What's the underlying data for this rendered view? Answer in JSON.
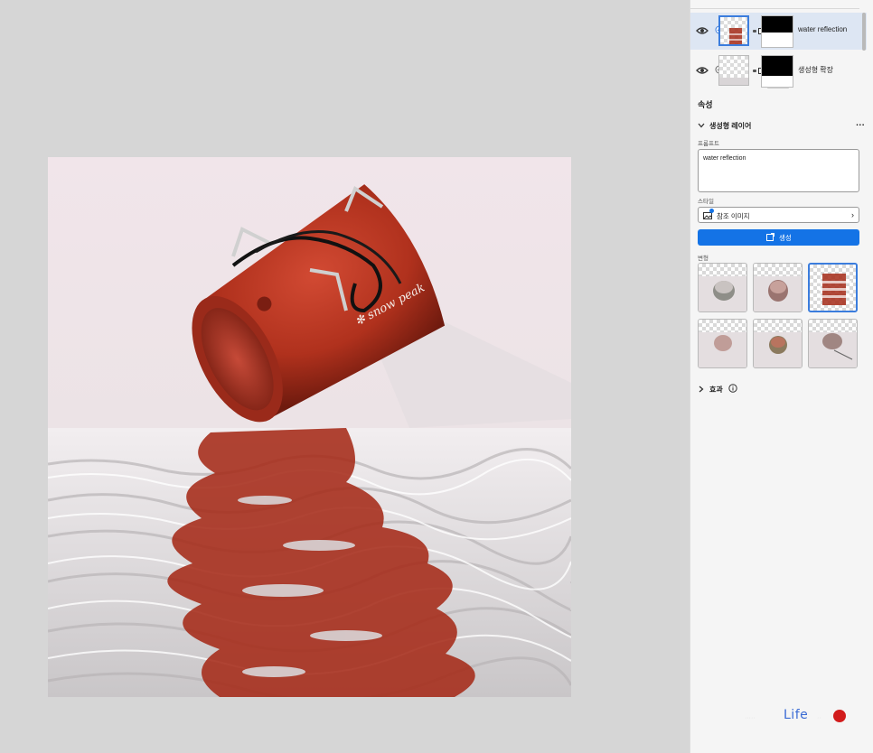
{
  "layers": [
    {
      "name": "water reflection",
      "selected": true,
      "visible": true,
      "icon": "eye-icon"
    },
    {
      "name": "생성형 확장",
      "selected": false,
      "visible": true,
      "icon": "eye-icon"
    }
  ],
  "properties": {
    "title": "속성",
    "section_title": "생성형 레이어",
    "more_label": "...",
    "prompt_label": "프롬프트",
    "prompt_value": "water reflection",
    "style_label": "스타일",
    "style_option": "참조 이미지",
    "generate_label": "생성",
    "variations_label": "변형",
    "variation_count": 6,
    "selected_variation": 3,
    "effects_label": "효과"
  },
  "watermark": {
    "left_text": "·····",
    "brand": "Life",
    "right_text": "··"
  },
  "colors": {
    "accent": "#1473e6",
    "selected_row": "#dde6f3",
    "canvas_bg": "#d6d6d6",
    "panel_bg": "#f5f5f5",
    "object_red": "#b5301d"
  }
}
